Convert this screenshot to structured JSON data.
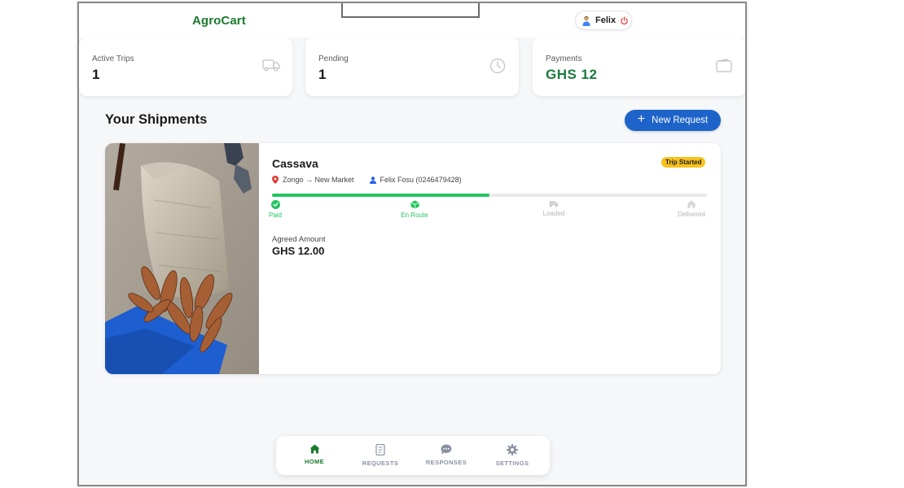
{
  "brand": "AgroCart",
  "user": {
    "name": "Felix"
  },
  "stats": [
    {
      "label": "Active Trips",
      "value": "1",
      "icon": "truck-icon"
    },
    {
      "label": "Pending",
      "value": "1",
      "icon": "clock-icon"
    },
    {
      "label": "Payments",
      "value": "GHS 12",
      "icon": "wallet-icon"
    }
  ],
  "section_title": "Your Shipments",
  "new_request_label": "New Request",
  "shipment": {
    "product": "Cassava",
    "route": "Zongo → New Market",
    "driver": "Felix Fosu (0246479428)",
    "status": "Trip Started",
    "progress_fraction": 0.5,
    "steps": [
      {
        "label": "Paid",
        "state": "done"
      },
      {
        "label": "En Route",
        "state": "current"
      },
      {
        "label": "Loaded",
        "state": "pending"
      },
      {
        "label": "Delivered",
        "state": "pending"
      }
    ],
    "amount_label": "Agreed Amount",
    "amount_value": "GHS 12.00"
  },
  "nav": [
    {
      "label": "HOME",
      "active": true
    },
    {
      "label": "REQUESTS",
      "active": false
    },
    {
      "label": "RESPONSES",
      "active": false
    },
    {
      "label": "SETTINGS",
      "active": false
    }
  ],
  "colors": {
    "brand_green": "#1b7a2e",
    "accent_blue": "#1d63c9",
    "progress_green": "#22c55e",
    "badge_yellow": "#f7c21a"
  }
}
